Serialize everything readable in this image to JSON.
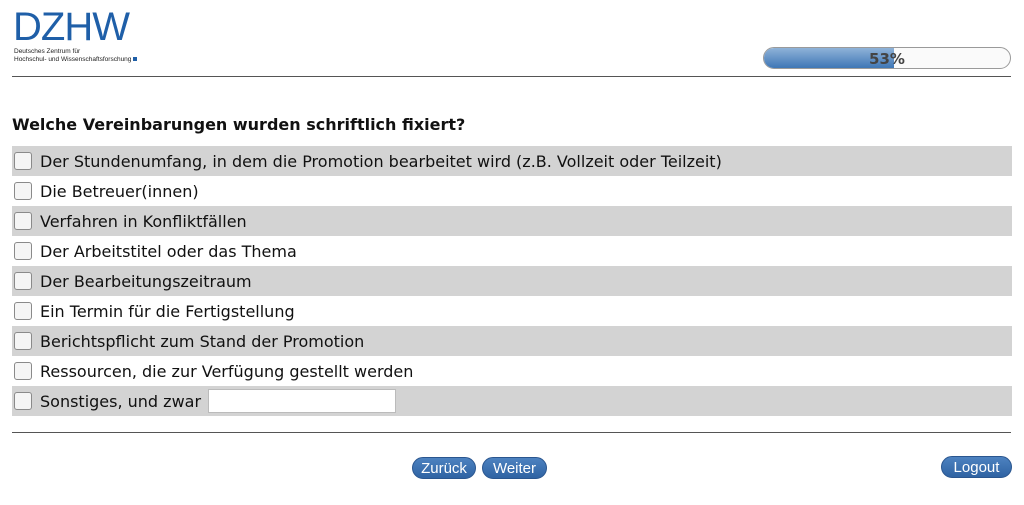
{
  "logo": {
    "wordmark": "DZHW",
    "line1": "Deutsches Zentrum für",
    "line2": "Hochschul- und Wissenschaftsforschung"
  },
  "progress": {
    "label": "53%",
    "value": 0.53
  },
  "question": "Welche Vereinbarungen wurden schriftlich fixiert?",
  "options": [
    "Der Stundenumfang, in dem die Promotion bearbeitet wird (z.B. Vollzeit oder Teilzeit)",
    "Die Betreuer(innen)",
    "Verfahren in Konfliktfällen",
    "Der Arbeitstitel oder das Thema",
    "Der Bearbeitungszeitraum",
    "Ein Termin für die Fertigstellung",
    "Berichtspflicht zum Stand der Promotion",
    "Ressourcen, die zur Verfügung gestellt werden",
    "Sonstiges, und zwar"
  ],
  "other_input": {
    "value": "",
    "placeholder": ""
  },
  "nav": {
    "back": "Zurück",
    "next": "Weiter",
    "logout": "Logout"
  },
  "colors": {
    "brand": "#1f5fa8",
    "button": "#3a6fb0",
    "row_shade": "#d3d3d3"
  }
}
